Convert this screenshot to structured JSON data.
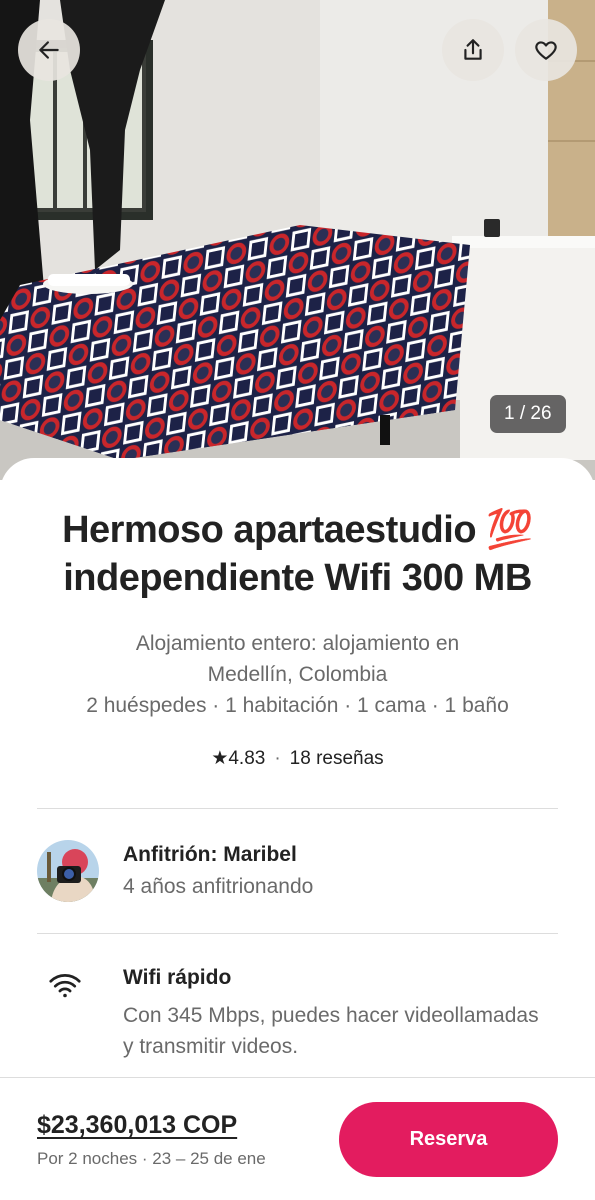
{
  "photo": {
    "counter": "1 / 26",
    "back_icon": "arrow-left-icon",
    "share_icon": "share-icon",
    "heart_icon": "heart-icon"
  },
  "listing": {
    "title_line1": "Hermoso apartaestudio 💯",
    "title_line2": "independiente Wifi 300 MB",
    "subtitle_line1": "Alojamiento entero: alojamiento en",
    "subtitle_line2": "Medellín, Colombia",
    "details": "2 huéspedes · 1 habitación · 1 cama · 1 baño",
    "rating_star": "★",
    "rating": "4.83",
    "rating_separator": "·",
    "reviews": "18 reseñas"
  },
  "host": {
    "label": "Anfitrión: Maribel",
    "experience": "4 años anfitrionando"
  },
  "feature": {
    "icon": "wifi-icon",
    "title": "Wifi rápido",
    "description": "Con 345 Mbps, puedes hacer videollamadas y transmitir videos."
  },
  "footer": {
    "price": "$23,360,013 COP",
    "price_detail": "Por 2 noches · 23 – 25 de ene",
    "reserve_label": "Reserva"
  },
  "colors": {
    "accent": "#e31c5f",
    "text_primary": "#222222",
    "text_secondary": "#6a6a6a",
    "divider": "#dddddd"
  }
}
